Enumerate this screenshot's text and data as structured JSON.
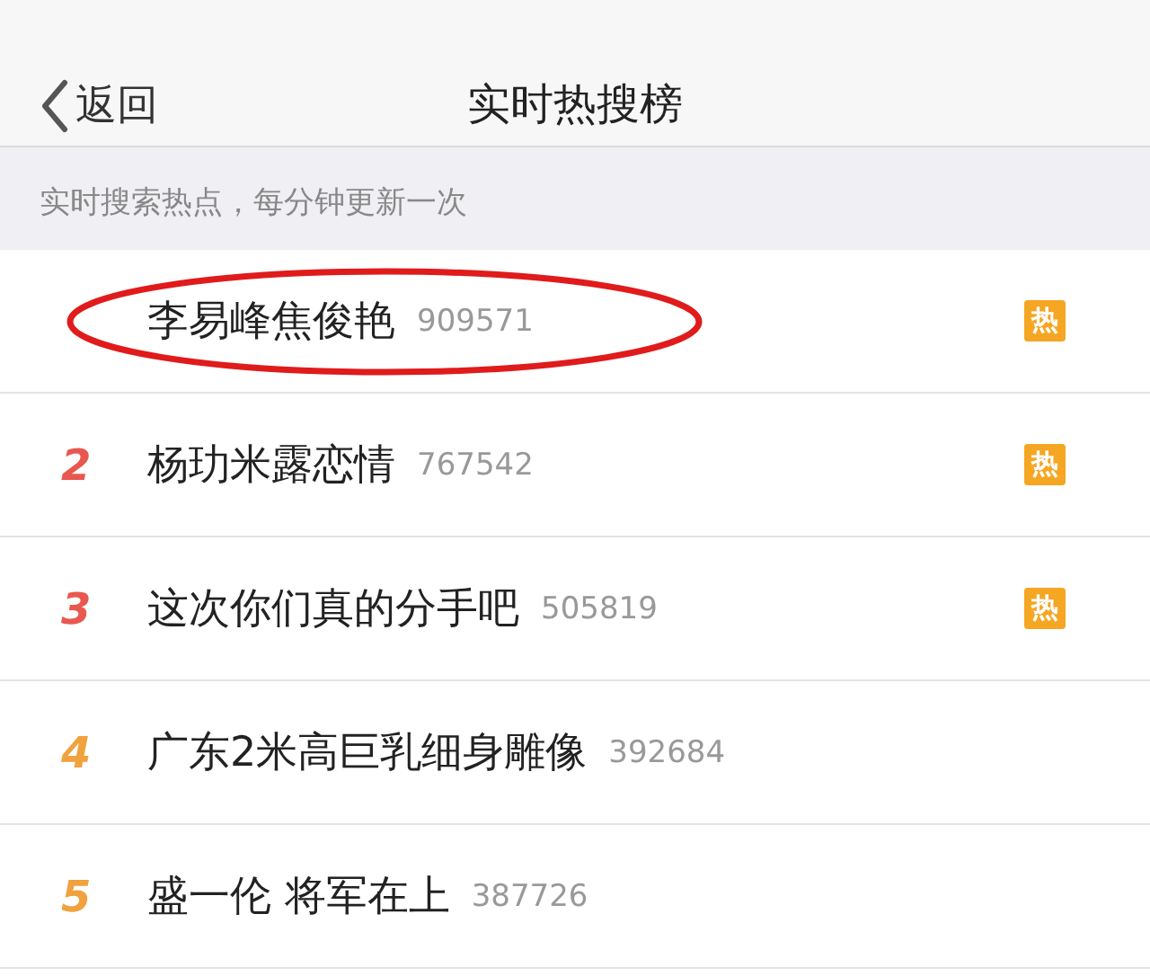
{
  "nav": {
    "back": "返回",
    "title": "实时热搜榜"
  },
  "subtitle": "实时搜索热点，每分钟更新一次",
  "rows": [
    {
      "topic": "李易峰焦俊艳",
      "count": "909571",
      "badge": "热",
      "circled": true
    },
    {
      "rank": "2",
      "color": "#e8584f",
      "topic": "杨玏米露恋情",
      "count": "767542",
      "badge": "热",
      "circled": false
    },
    {
      "rank": "3",
      "color": "#e8584f",
      "topic": "这次你们真的分手吧",
      "count": "505819",
      "badge": "热",
      "circled": false
    },
    {
      "rank": "4",
      "color": "#f0a23e",
      "topic": "广东2米高巨乳细身雕像",
      "count": "392684",
      "circled": false
    },
    {
      "rank": "5",
      "color": "#f0a23e",
      "topic": "盛一伦 将军在上",
      "count": "387726",
      "circled": false
    }
  ]
}
